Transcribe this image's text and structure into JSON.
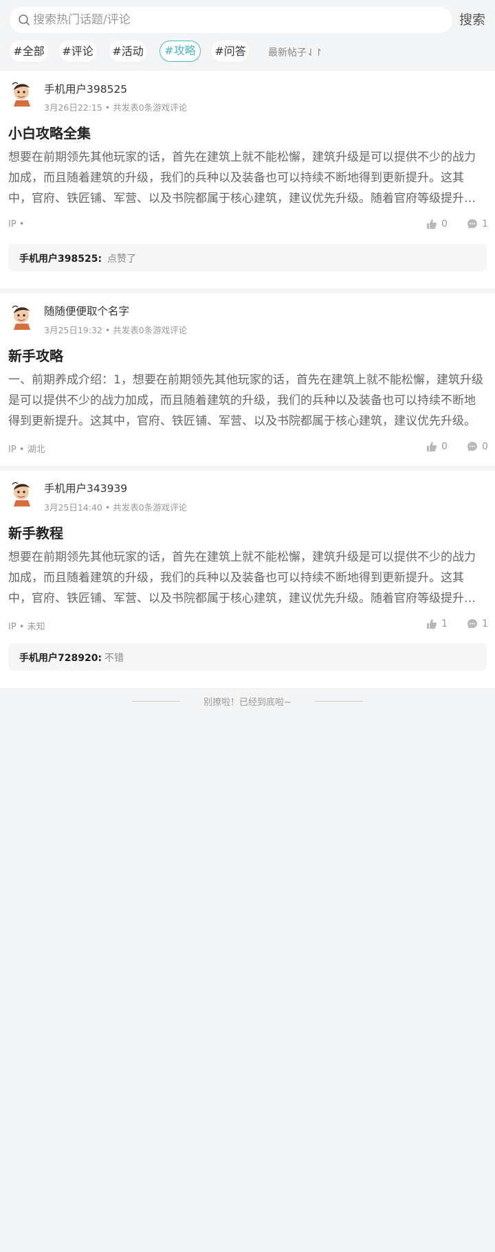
{
  "search": {
    "placeholder": "搜索热门话题/评论",
    "button_label": "搜索"
  },
  "tags": [
    {
      "label": "#全部",
      "active": false
    },
    {
      "label": "#评论",
      "active": false
    },
    {
      "label": "#活动",
      "active": false
    },
    {
      "label": "#攻略",
      "active": true
    },
    {
      "label": "#问答",
      "active": false
    }
  ],
  "sort_label": "最新帖子⇃↾",
  "accent_color": "#4fb8c6",
  "posts": [
    {
      "author": "手机用户398525",
      "meta": "3月26日22:15 • 共发表0条游戏评论",
      "title": "小白攻略全集",
      "body": "想要在前期领先其他玩家的话，首先在建筑上就不能松懈，建筑升级是可以提供不少的战力加成，而且随着建筑的升级，我们的兵种以及装备也可以持续不断地得到更新提升。这其中，官府、铁匠铺、军营、以及书院都属于核心建筑，建议优先升级。随着官府等级提升，解锁更多功能。",
      "ip": "IP •",
      "likes": "0",
      "comments": "1",
      "comment": {
        "user": "手机用户398525:",
        "text": "点赞了"
      }
    },
    {
      "author": "随随便便取个名字",
      "meta": "3月25日19:32 • 共发表0条游戏评论",
      "title": "新手攻略",
      "body": "一、前期养成介绍：1，想要在前期领先其他玩家的话，首先在建筑上就不能松懈，建筑升级是可以提供不少的战力加成，而且随着建筑的升级，我们的兵种以及装备也可以持续不断地得到更新提升。这其中，官府、铁匠铺、军营、以及书院都属于核心建筑，建议优先升级。",
      "ip": "IP • 湖北",
      "likes": "0",
      "comments": "0"
    },
    {
      "author": "手机用户343939",
      "meta": "3月25日14:40 • 共发表0条游戏评论",
      "title": "新手教程",
      "body": "想要在前期领先其他玩家的话，首先在建筑上就不能松懈，建筑升级是可以提供不少的战力加成，而且随着建筑的升级，我们的兵种以及装备也可以持续不断地得到更新提升。这其中，官府、铁匠铺、军营、以及书院都属于核心建筑，建议优先升级。随着官府等级提升，解锁更多功能。",
      "ip": "IP • 未知",
      "likes": "1",
      "comments": "1",
      "comment": {
        "user": "手机用户728920:",
        "text": "不错"
      }
    }
  ],
  "end_text": "别撩啦！已经到底啦~"
}
